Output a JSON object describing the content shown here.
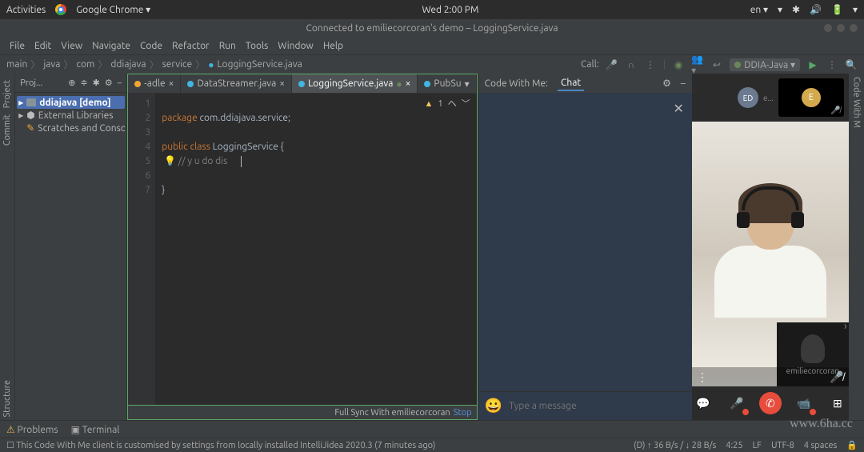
{
  "os": {
    "activities": "Activities",
    "app": "Google Chrome ▾",
    "clock": "Wed  2:00 PM",
    "lang": "en ▾"
  },
  "title": "Connected to emiliecorcoran's demo – LoggingService.java",
  "menu": [
    "File",
    "Edit",
    "View",
    "Navigate",
    "Code",
    "Refactor",
    "Run",
    "Tools",
    "Window",
    "Help"
  ],
  "breadcrumb": [
    "main",
    "java",
    "com",
    "ddiajava",
    "service",
    "LoggingService.java"
  ],
  "nav": {
    "call": "Call:",
    "config": "DDIA-Java ▾"
  },
  "project": {
    "title": "Proj...",
    "items": [
      {
        "label": "ddiajava [demo]",
        "sel": true,
        "icon": "folder"
      },
      {
        "label": "External Libraries",
        "sel": false,
        "icon": "lib"
      },
      {
        "label": "Scratches and Conso",
        "sel": false,
        "icon": "scratch"
      }
    ]
  },
  "tabs": [
    {
      "label": "-adle",
      "active": false,
      "icon": "orange",
      "close": true
    },
    {
      "label": "DataStreamer.java",
      "active": false,
      "icon": "blue",
      "close": true
    },
    {
      "label": "LoggingService.java",
      "active": true,
      "icon": "blue",
      "badge": true,
      "close": true
    },
    {
      "label": "PubSu",
      "active": false,
      "icon": "blue",
      "chev": true
    }
  ],
  "code": {
    "lines": [
      "1",
      "2",
      "3",
      "4",
      "5",
      "6",
      "7"
    ],
    "l1_kw": "package ",
    "l1_rest": "com.ddiajava.service;",
    "l3_kw1": "public class ",
    "l3_cls": "LoggingService ",
    "l3_brace": "{",
    "l4_cmt": "// y u do dis",
    "l6": "}",
    "warn_count": "1",
    "caret_up": "ヘ",
    "caret_down": "﹀"
  },
  "sync": {
    "text": "Full Sync With emiliecorcoran",
    "stop": "Stop"
  },
  "chat": {
    "cwm": "Code With Me:",
    "tab": "Chat",
    "placeholder": "Type a message"
  },
  "video": {
    "avatar1": "ED",
    "avatar2": "e...",
    "avatar_big": "E",
    "pip_name": "emiliecorcoran"
  },
  "sidebars": {
    "left": [
      "Project",
      "Commit"
    ],
    "left_bottom": "Structure",
    "right": "Code With M"
  },
  "bottom": {
    "problems": "Problems",
    "terminal": "Terminal"
  },
  "status": {
    "msg": "This Code With Me client is customised by settings from locally installed IntelliJidea 2020.3 (7 minutes ago)",
    "net": "(D) ↑ 36 B/s / ↓ 28 B/s",
    "pos": "4:25",
    "sep": "LF",
    "enc": "UTF-8",
    "indent": "4 spaces"
  },
  "watermark": "www.6ha.cc"
}
